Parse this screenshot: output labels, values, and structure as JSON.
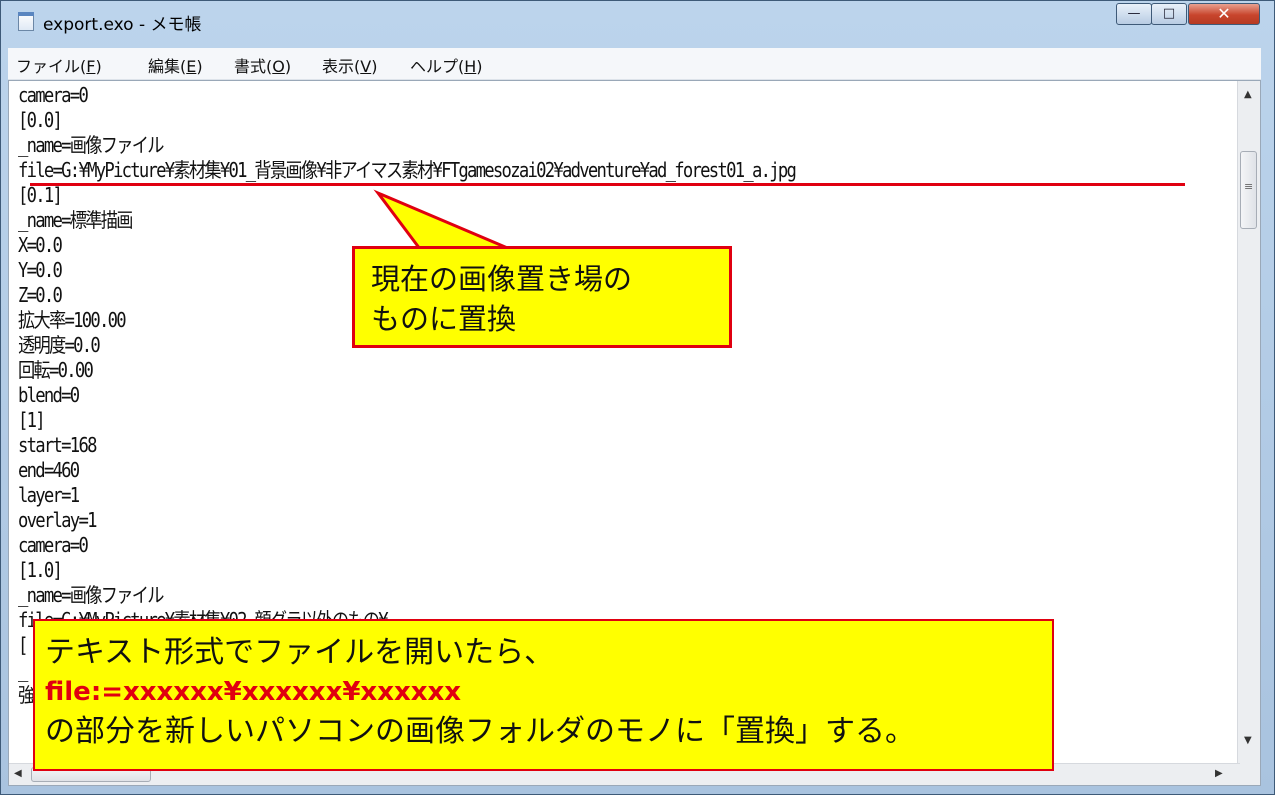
{
  "window": {
    "title": "export.exo - メモ帳",
    "minimize_glyph": "—",
    "maximize_glyph": "□",
    "close_glyph": "✕"
  },
  "menu": {
    "items": [
      {
        "label": "ファイル(",
        "key": "F",
        "tail": ")"
      },
      {
        "label": "編集(",
        "key": "E",
        "tail": ")"
      },
      {
        "label": "書式(",
        "key": "O",
        "tail": ")"
      },
      {
        "label": "表示(",
        "key": "V",
        "tail": ")"
      },
      {
        "label": "ヘルプ(",
        "key": "H",
        "tail": ")"
      }
    ]
  },
  "editor": {
    "lines": [
      "camera=0",
      "[0.0]",
      "_name=画像ファイル",
      "file=G:¥MyPicture¥素材集¥01_背景画像¥非アイマス素材¥FTgamesozai02¥adventure¥ad_forest01_a.jpg",
      "[0.1]",
      "_name=標準描画",
      "X=0.0",
      "Y=0.0",
      "Z=0.0",
      "拡大率=100.00",
      "透明度=0.0",
      "回転=0.00",
      "blend=0",
      "[1]",
      "start=168",
      "end=460",
      "layer=1",
      "overlay=1",
      "camera=0",
      "[1.0]",
      "_name=画像ファイル",
      "file=G:¥MyPicture¥素材集¥02_顔グラ以外のもの¥...",
      "[",
      "_",
      "強"
    ]
  },
  "scrollbar": {
    "up_arrow": "▲",
    "down_arrow": "▼",
    "left_arrow": "◀",
    "right_arrow": "▶",
    "thumb_glyph": "≡"
  },
  "callout": {
    "line1": "現在の画像置き場の",
    "line2": "ものに置換"
  },
  "note": {
    "line1": "テキスト形式でファイルを開いたら、",
    "line2": "file:=xxxxxx¥xxxxxx¥xxxxxx",
    "line3": "の部分を新しいパソコンの画像フォルダのモノに「置換」する。"
  },
  "colors": {
    "highlight": "#ffff00",
    "accent_red": "#e00010"
  }
}
